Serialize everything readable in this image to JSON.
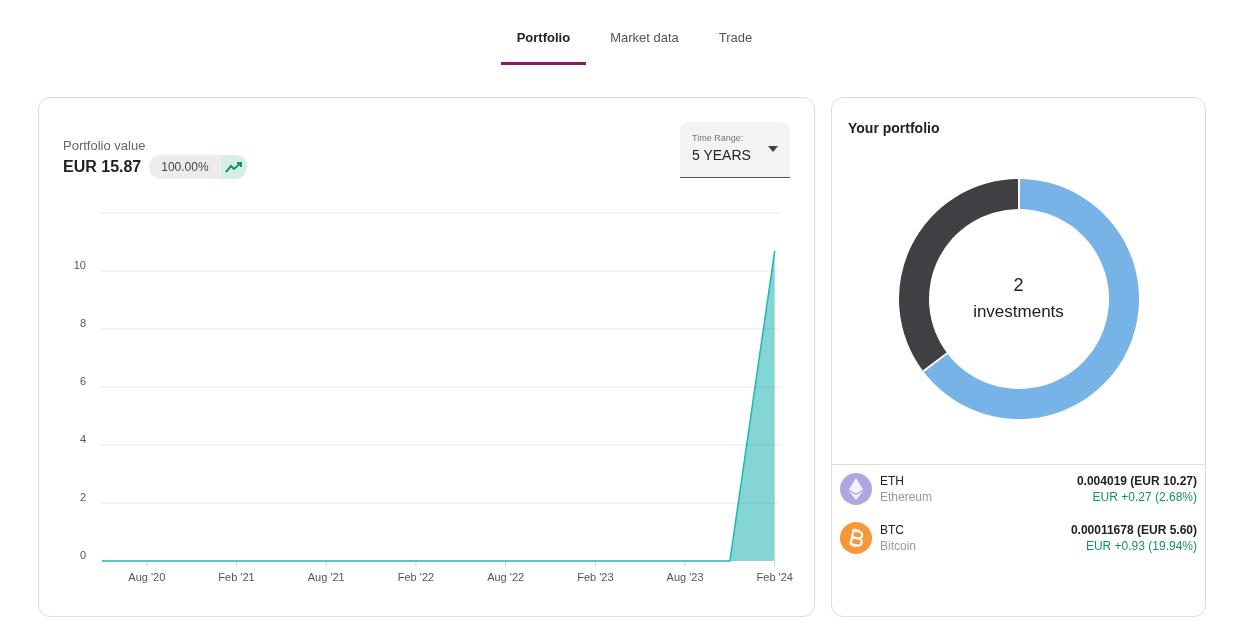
{
  "tabs": [
    {
      "label": "Portfolio",
      "selected": true
    },
    {
      "label": "Market data",
      "selected": false
    },
    {
      "label": "Trade",
      "selected": false
    }
  ],
  "value_card": {
    "label": "Portfolio value",
    "value": "EUR 15.87",
    "change": "100.00%",
    "time_range": {
      "label": "Time Range:",
      "value": "5 YEARS"
    },
    "chart_data": {
      "type": "area",
      "grid": true,
      "categories": [
        null,
        "Aug '20",
        null,
        "Feb '21",
        null,
        "Aug '21",
        null,
        "Feb '22",
        null,
        "Aug '22",
        null,
        "Feb '23",
        null,
        "Aug '23",
        null,
        "Feb '24"
      ],
      "series": [
        {
          "color": "#1fb5b5",
          "values": [
            0,
            0,
            0,
            0,
            0,
            0,
            0,
            0,
            0,
            0,
            0,
            0,
            0,
            0,
            0,
            10.7
          ]
        }
      ],
      "ylim": [
        0,
        12
      ],
      "yticks": [
        0,
        2,
        4,
        6,
        8,
        10
      ]
    }
  },
  "portfolio": {
    "title": "Your portfolio",
    "count": "2",
    "count_label": "investments",
    "chart_data": {
      "type": "donut",
      "values": [
        64.71,
        35.29
      ],
      "colors": [
        "#78b3e8",
        "#404044"
      ]
    },
    "holdings": [
      {
        "kind": "eth",
        "symbol": "ETH",
        "name": "Ethereum",
        "amount": "0.004019 (EUR 10.27)",
        "change": "EUR +0.27 (2.68%)"
      },
      {
        "kind": "btc",
        "symbol": "BTC",
        "name": "Bitcoin",
        "amount": "0.00011678 (EUR 5.60)",
        "change": "EUR +0.93 (19.94%)"
      }
    ]
  }
}
